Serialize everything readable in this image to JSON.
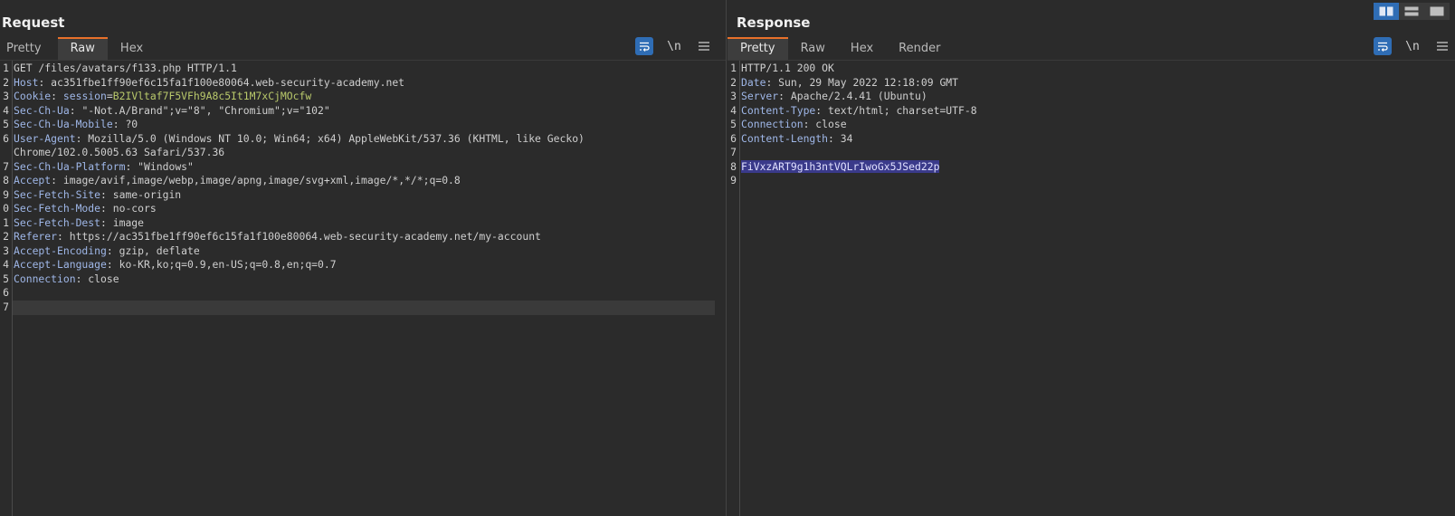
{
  "request": {
    "title": "Request",
    "tabs": [
      "Pretty",
      "Raw",
      "Hex"
    ],
    "active_tab": "Raw",
    "lines": [
      {
        "n": "1",
        "type": "start",
        "text": "GET /files/avatars/f133.php HTTP/1.1"
      },
      {
        "n": "2",
        "type": "header",
        "name": "Host",
        "value": ": ac351fbe1ff90ef6c15fa1f100e80064.web-security-academy.net"
      },
      {
        "n": "3",
        "type": "cookie",
        "name": "Cookie",
        "value": ": ",
        "cookie_name": "session",
        "cookie_eq": "=",
        "cookie_value": "B2IVltaf7F5VFh9A8c5It1M7xCjMOcfw"
      },
      {
        "n": "4",
        "type": "header",
        "name": "Sec-Ch-Ua",
        "value": ": \"-Not.A/Brand\";v=\"8\", \"Chromium\";v=\"102\""
      },
      {
        "n": "5",
        "type": "header",
        "name": "Sec-Ch-Ua-Mobile",
        "value": ": ?0"
      },
      {
        "n": "6",
        "type": "header",
        "name": "User-Agent",
        "value": ": Mozilla/5.0 (Windows NT 10.0; Win64; x64) AppleWebKit/537.36 (KHTML, like Gecko)"
      },
      {
        "n": "",
        "type": "plain",
        "text": "Chrome/102.0.5005.63 Safari/537.36"
      },
      {
        "n": "7",
        "type": "header",
        "name": "Sec-Ch-Ua-Platform",
        "value": ": \"Windows\""
      },
      {
        "n": "8",
        "type": "header",
        "name": "Accept",
        "value": ": image/avif,image/webp,image/apng,image/svg+xml,image/*,*/*;q=0.8"
      },
      {
        "n": "9",
        "type": "header",
        "name": "Sec-Fetch-Site",
        "value": ": same-origin"
      },
      {
        "n": "0",
        "type": "header",
        "name": "Sec-Fetch-Mode",
        "value": ": no-cors"
      },
      {
        "n": "1",
        "type": "header",
        "name": "Sec-Fetch-Dest",
        "value": ": image"
      },
      {
        "n": "2",
        "type": "header",
        "name": "Referer",
        "value": ": https://ac351fbe1ff90ef6c15fa1f100e80064.web-security-academy.net/my-account"
      },
      {
        "n": "3",
        "type": "header",
        "name": "Accept-Encoding",
        "value": ": gzip, deflate"
      },
      {
        "n": "4",
        "type": "header",
        "name": "Accept-Language",
        "value": ": ko-KR,ko;q=0.9,en-US;q=0.8,en;q=0.7"
      },
      {
        "n": "5",
        "type": "header",
        "name": "Connection",
        "value": ": close"
      },
      {
        "n": "6",
        "type": "plain",
        "text": ""
      },
      {
        "n": "7",
        "type": "plain",
        "text": "",
        "current": true
      }
    ]
  },
  "response": {
    "title": "Response",
    "tabs": [
      "Pretty",
      "Raw",
      "Hex",
      "Render"
    ],
    "active_tab": "Pretty",
    "lines": [
      {
        "n": "1",
        "type": "start",
        "text": "HTTP/1.1 200 OK"
      },
      {
        "n": "2",
        "type": "header",
        "name": "Date",
        "value": ": Sun, 29 May 2022 12:18:09 GMT"
      },
      {
        "n": "3",
        "type": "header",
        "name": "Server",
        "value": ": Apache/2.4.41 (Ubuntu)"
      },
      {
        "n": "4",
        "type": "header",
        "name": "Content-Type",
        "value": ": text/html; charset=UTF-8"
      },
      {
        "n": "5",
        "type": "header",
        "name": "Connection",
        "value": ": close"
      },
      {
        "n": "6",
        "type": "header",
        "name": "Content-Length",
        "value": ": 34"
      },
      {
        "n": "7",
        "type": "plain",
        "text": ""
      },
      {
        "n": "8",
        "type": "selected",
        "text": "FiVxzART9g1h3ntVQLrIwoGx5JSed22p"
      },
      {
        "n": "9",
        "type": "plain",
        "text": ""
      }
    ]
  },
  "toolbar": {
    "wrap_icon": "wrap-lines-icon",
    "newline_label": "\\n",
    "menu_icon": "hamburger-menu-icon"
  },
  "layout_buttons": [
    "split-horizontal-icon",
    "split-vertical-icon",
    "single-pane-icon"
  ],
  "colors": {
    "accent": "#e8702a",
    "active_button": "#2f6db5",
    "header_name": "#9fb7e8",
    "cookie_value": "#b9c96b",
    "selection": "#3a3a8a"
  }
}
